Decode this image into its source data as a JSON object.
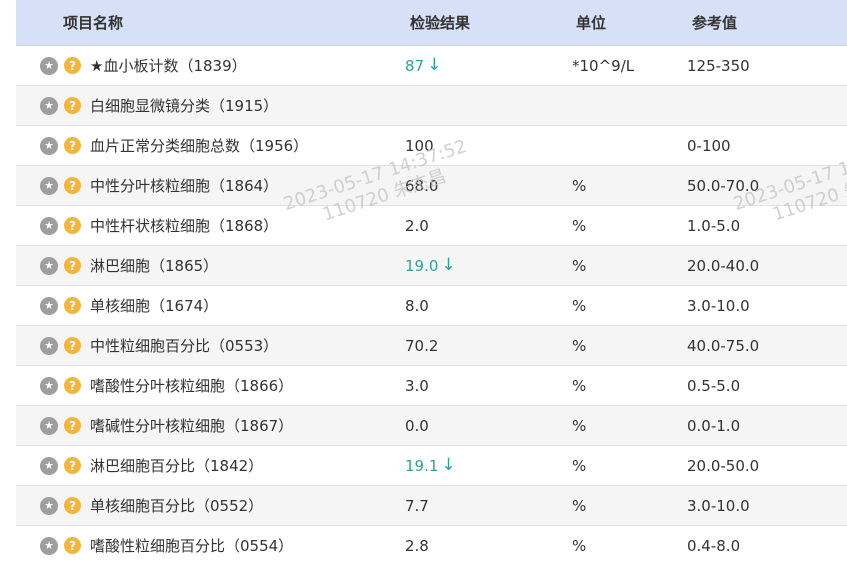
{
  "header": {
    "name": "项目名称",
    "result": "检验结果",
    "unit": "单位",
    "reference": "参考值"
  },
  "rows": [
    {
      "name": "★血小板计数（1839）",
      "result": "87",
      "flag": "↓",
      "unit": "*10^9/L",
      "reference": "125-350"
    },
    {
      "name": "白细胞显微镜分类（1915）",
      "result": "",
      "flag": "",
      "unit": "",
      "reference": ""
    },
    {
      "name": "血片正常分类细胞总数（1956）",
      "result": "100",
      "flag": "",
      "unit": "",
      "reference": "0-100"
    },
    {
      "name": "中性分叶核粒细胞（1864）",
      "result": "68.0",
      "flag": "",
      "unit": "%",
      "reference": "50.0-70.0"
    },
    {
      "name": "中性杆状核粒细胞（1868）",
      "result": "2.0",
      "flag": "",
      "unit": "%",
      "reference": "1.0-5.0"
    },
    {
      "name": "淋巴细胞（1865）",
      "result": "19.0",
      "flag": "↓",
      "unit": "%",
      "reference": "20.0-40.0"
    },
    {
      "name": "单核细胞（1674）",
      "result": "8.0",
      "flag": "",
      "unit": "%",
      "reference": "3.0-10.0"
    },
    {
      "name": "中性粒细胞百分比（0553）",
      "result": "70.2",
      "flag": "",
      "unit": "%",
      "reference": "40.0-75.0"
    },
    {
      "name": "嗜酸性分叶核粒细胞（1866）",
      "result": "3.0",
      "flag": "",
      "unit": "%",
      "reference": "0.5-5.0"
    },
    {
      "name": "嗜碱性分叶核粒细胞（1867）",
      "result": "0.0",
      "flag": "",
      "unit": "%",
      "reference": "0.0-1.0"
    },
    {
      "name": "淋巴细胞百分比（1842）",
      "result": "19.1",
      "flag": "↓",
      "unit": "%",
      "reference": "20.0-50.0"
    },
    {
      "name": "单核细胞百分比（0552）",
      "result": "7.7",
      "flag": "",
      "unit": "%",
      "reference": "3.0-10.0"
    },
    {
      "name": "嗜酸性粒细胞百分比（0554）",
      "result": "2.8",
      "flag": "",
      "unit": "%",
      "reference": "0.4-8.0"
    }
  ],
  "icons": {
    "star": "★",
    "help": "?"
  },
  "watermark": {
    "line1": "2023-05-17 14:37:52",
    "line2": "110720 朱杰昌",
    "partial_line1": "2023-05-17 1",
    "partial_line2": "110720 朱"
  },
  "colors": {
    "header_bg": "#d6e1f7",
    "low_value": "#2aa59a",
    "help_icon": "#f4b53a",
    "star_icon": "#9e9e9e"
  }
}
